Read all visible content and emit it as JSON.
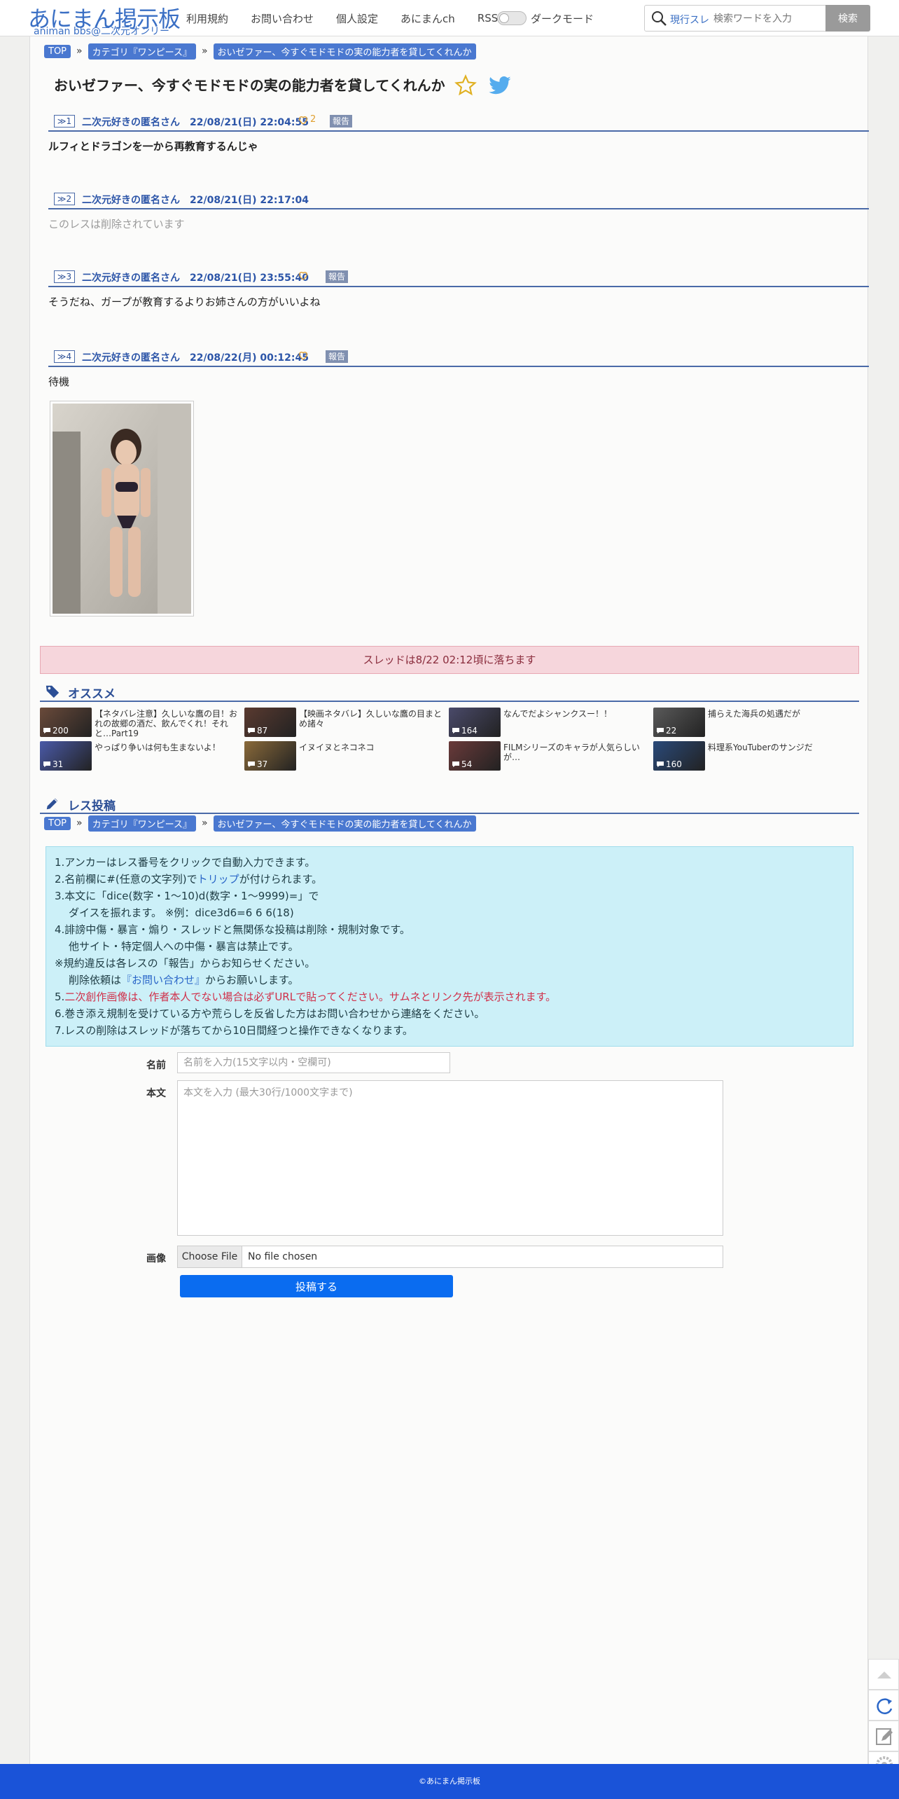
{
  "header": {
    "logo_main": "あにまん掲示板",
    "logo_sub": "animan bbs@二次元オンリー",
    "nav": [
      "利用規約",
      "お問い合わせ",
      "個人設定",
      "あにまんch",
      "RSS"
    ],
    "dark_mode_label": "ダークモード",
    "search_scope": "現行スレ",
    "search_placeholder": "検索ワードを入力",
    "search_button": "検索"
  },
  "breadcrumb": {
    "top": "TOP",
    "sep": "»",
    "category": "カテゴリ『ワンピース』",
    "thread": "おいゼファー、今すぐモドモドの実の能力者を貸してくれんか"
  },
  "thread_title": "おいゼファー、今すぐモドモドの実の能力者を貸してくれんか",
  "posts": [
    {
      "anchor": "≫1",
      "meta": "二次元好きの匿名さん　22/08/21(日) 22:04:55",
      "likes": "2",
      "report": "報告",
      "body": "ルフィとドラゴンを一から再教育するんじゃ"
    },
    {
      "anchor": "≫2",
      "meta": "二次元好きの匿名さん　22/08/21(日) 22:17:04",
      "body": "このレスは削除されています"
    },
    {
      "anchor": "≫3",
      "meta": "二次元好きの匿名さん　22/08/21(日) 23:55:40",
      "report": "報告",
      "body": "そうだね、ガープが教育するよりお姉さんの方がいいよね"
    },
    {
      "anchor": "≫4",
      "meta": "二次元好きの匿名さん　22/08/22(月) 00:12:45",
      "report": "報告",
      "body": "待機"
    }
  ],
  "drop_notice": "スレッドは8/22 02:12頃に落ちます",
  "recommend": {
    "title": "オススメ",
    "items": [
      {
        "count": "200",
        "text": "【ネタバレ注意】久しいな鷹の目！おれの故郷の酒だ、飲んでくれ！それと…Part19",
        "color": "#6a4a3a"
      },
      {
        "count": "87",
        "text": "【映画ネタバレ】久しいな鷹の目まとめ諸々",
        "color": "#5a3a30"
      },
      {
        "count": "164",
        "text": "なんでだよシャンクスー！！",
        "color": "#4a4a6a"
      },
      {
        "count": "22",
        "text": "捕らえた海兵の処遇だが",
        "color": "#5a5a5a"
      },
      {
        "count": "31",
        "text": "やっぱり争いは何も生まないよ！",
        "color": "#4a5aa8"
      },
      {
        "count": "37",
        "text": "イヌイヌとネコネコ",
        "color": "#8a6a3a"
      },
      {
        "count": "54",
        "text": "FILMシリーズのキャラが人気らしいが…",
        "color": "#6a3a3a"
      },
      {
        "count": "160",
        "text": "料理系YouTuberのサンジだ",
        "color": "#2a4a7a"
      }
    ]
  },
  "reply": {
    "title": "レス投稿",
    "rules": {
      "r1": "1.アンカーはレス番号をクリックで自動入力できます。",
      "r2_a": "2.名前欄に#(任意の文字列)で",
      "r2_link": "トリップ",
      "r2_b": "が付けられます。",
      "r3": "3.本文に「dice(数字・1～10)d(数字・1～9999)=」で",
      "r3_b": "ダイスを振れます。 ※例：dice3d6=6 6 6(18)",
      "r4": "4.誹謗中傷・暴言・煽り・スレッドと無関係な投稿は削除・規制対象です。",
      "r4_b": "他サイト・特定個人への中傷・暴言は禁止です。",
      "r5": "※規約違反は各レスの「報告」からお知らせください。",
      "r5_a": "削除依頼は",
      "r5_link": "『お問い合わせ』",
      "r5_b": "からお願いします。",
      "r6_num": "5.",
      "r6_red": "二次創作画像は、作者本人でない場合は必ずURLで貼ってください。サムネとリンク先が表示されます。",
      "r7": "6.巻き添え規制を受けている方や荒らしを反省した方はお問い合わせから連絡をください。",
      "r8": "7.レスの削除はスレッドが落ちてから10日間経つと操作できなくなります。"
    },
    "name_label": "名前",
    "name_placeholder": "名前を入力(15文字以内・空欄可)",
    "body_label": "本文",
    "body_placeholder": "本文を入力 (最大30行/1000文字まで)",
    "image_label": "画像",
    "file_button": "Choose File",
    "file_status": "No file chosen",
    "submit": "投稿する"
  },
  "footer": "©あにまん掲示板",
  "colors": {
    "accent": "#4a78d0",
    "link": "#2c55a8",
    "footer": "#1a53d8",
    "submit": "#0a6cf0"
  }
}
